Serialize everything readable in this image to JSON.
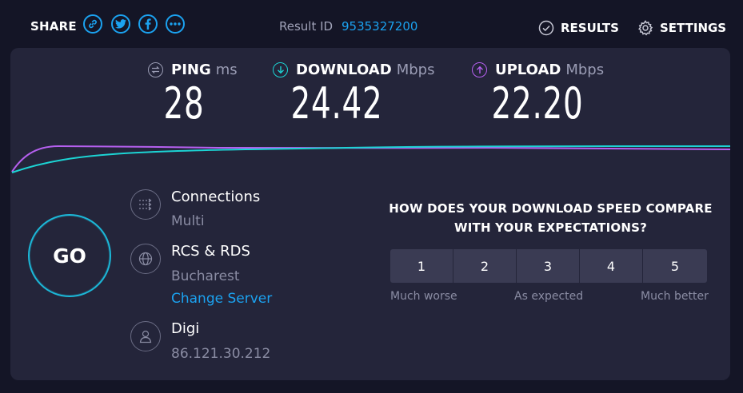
{
  "header": {
    "share_label": "SHARE",
    "share_buttons": [
      {
        "icon": "link-icon"
      },
      {
        "icon": "twitter-icon"
      },
      {
        "icon": "facebook-icon"
      },
      {
        "icon": "more-icon"
      }
    ],
    "result_label": "Result ID",
    "result_id": "9535327200",
    "results_label": "RESULTS",
    "settings_label": "SETTINGS"
  },
  "metrics": {
    "ping": {
      "label": "PING",
      "unit": "ms",
      "value": "28",
      "color": "#9a9cb4"
    },
    "download": {
      "label": "DOWNLOAD",
      "unit": "Mbps",
      "value": "24.42",
      "color": "#1cd4d4"
    },
    "upload": {
      "label": "UPLOAD",
      "unit": "Mbps",
      "value": "22.20",
      "color": "#b660f0"
    }
  },
  "go_label": "GO",
  "connections": {
    "title": "Connections",
    "value": "Multi"
  },
  "server": {
    "title": "RCS & RDS",
    "location": "Bucharest",
    "change_label": "Change Server"
  },
  "provider": {
    "title": "Digi",
    "ip": "86.121.30.212"
  },
  "survey": {
    "question": "HOW DOES YOUR DOWNLOAD SPEED COMPARE WITH YOUR EXPECTATIONS?",
    "options": [
      "1",
      "2",
      "3",
      "4",
      "5"
    ],
    "low_label": "Much worse",
    "mid_label": "As expected",
    "high_label": "Much better"
  },
  "colors": {
    "accent": "#1ba2f0",
    "download": "#1cd4d4",
    "upload": "#b660f0",
    "background": "#141526",
    "panel": "#24253a"
  }
}
